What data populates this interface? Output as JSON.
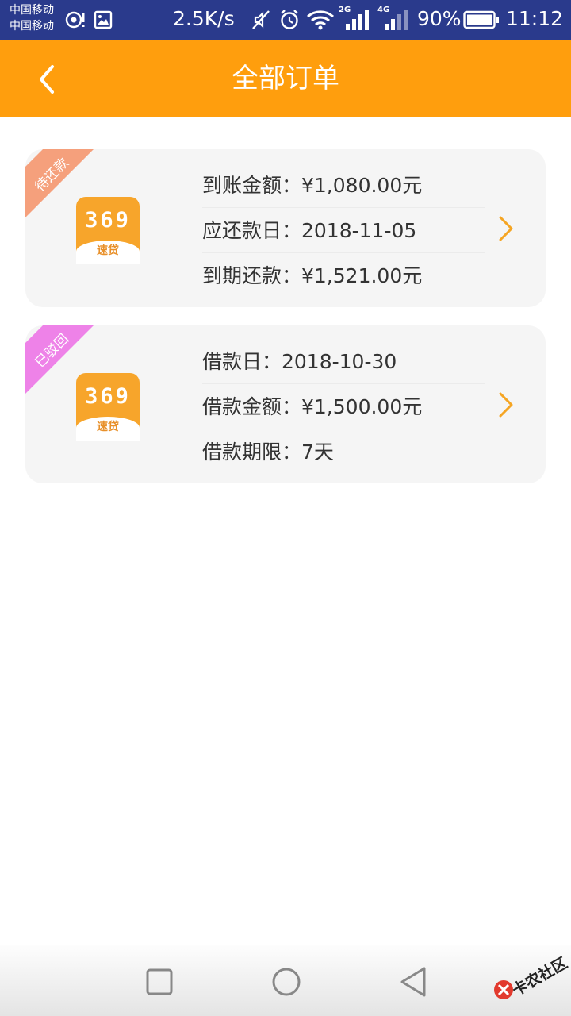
{
  "status_bar": {
    "carrier_1": "中国移动",
    "carrier_2": "中国移动",
    "net_speed": "2.5K/s",
    "signal_1_label": "2G",
    "signal_2_label": "4G",
    "battery": "90%",
    "time": "11:12"
  },
  "header": {
    "title": "全部订单"
  },
  "orders": [
    {
      "status": "待还款",
      "status_color": "#f5a07c",
      "rows": [
        "到账金额：¥1,080.00元",
        "应还款日：2018-11-05",
        "到期还款：¥1,521.00元"
      ]
    },
    {
      "status": "已驳回",
      "status_color": "#ee82e8",
      "rows": [
        "借款日：2018-10-30",
        "借款金额：¥1,500.00元",
        "借款期限：7天"
      ]
    }
  ],
  "logo": {
    "digits": "369",
    "sub": "速贷"
  },
  "colors": {
    "accent": "#ff9e0d",
    "chevron": "#f5a523",
    "status_bar": "#2a3a8c"
  },
  "watermark": "卡农社区",
  "icons": {
    "back": "chevron-left-icon",
    "row_arrow": "chevron-right-icon",
    "nav_recent": "square-icon",
    "nav_home": "circle-icon",
    "nav_back": "triangle-back-icon"
  }
}
